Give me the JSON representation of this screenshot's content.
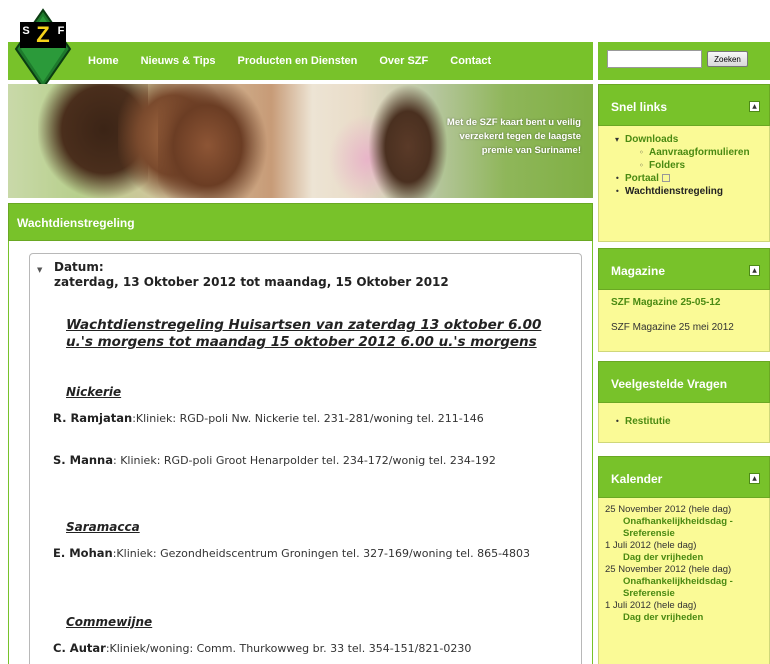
{
  "logo": {
    "letters": "SZF",
    "accent": "#78c22a"
  },
  "nav": {
    "items": [
      "Home",
      "Nieuws & Tips",
      "Producten en Diensten",
      "Over SZF",
      "Contact"
    ]
  },
  "search": {
    "value": "",
    "button_label": "Zoeken"
  },
  "banner": {
    "text": "Met de SZF kaart bent u veilig verzekerd tegen de laagste premie van Suriname!"
  },
  "main": {
    "header": "Wachtdienstregeling",
    "datum_label": "Datum:",
    "datum_value": "zaterdag, 13 Oktober 2012 tot maandag, 15 Oktober 2012",
    "title": "Wachtdienstregeling Huisartsen van zaterdag 13 oktober  6.00 u.'s morgens tot maandag 15 oktober 2012 6.00 u.'s morgens",
    "districts": [
      {
        "name": "Nickerie",
        "entries": [
          {
            "name": "R. Ramjatan",
            "detail": ":Kliniek:  RGD-poli Nw. Nickerie tel.  231-281/woning tel.  211-146"
          },
          {
            "name": "S. Manna",
            "detail": ": Kliniek: RGD-poli Groot Henarpolder tel. 234-172/wonig tel. 234-192"
          }
        ]
      },
      {
        "name": "Saramacca",
        "entries": [
          {
            "name": "E. Mohan",
            "detail": ":Kliniek:   Gezondheidscentrum Groningen tel.   327-169/woning tel.  865-4803"
          }
        ]
      },
      {
        "name": "Commewijne",
        "entries": [
          {
            "name": "C. Autar",
            "detail": ":Kliniek/woning:  Comm. Thurkowweg br. 33 tel.  354-151/821-0230"
          }
        ]
      }
    ]
  },
  "sidebar": {
    "quicklinks": {
      "title": "Snel links",
      "items": [
        {
          "label": "Downloads",
          "level": 1,
          "bullet": "▾"
        },
        {
          "label": "Aanvraagformulieren",
          "level": 2,
          "bullet": "◦"
        },
        {
          "label": "Folders",
          "level": 2,
          "bullet": "◦"
        },
        {
          "label": "Portaal",
          "level": 1,
          "bullet": "•",
          "external": true
        },
        {
          "label": "Wachtdienstregeling",
          "level": 1,
          "bullet": "•",
          "active": true
        }
      ]
    },
    "magazine": {
      "title": "Magazine",
      "link": "SZF Magazine 25-05-12",
      "text": "SZF Magazine 25 mei 2012"
    },
    "faq": {
      "title": "Veelgestelde Vragen",
      "items": [
        "Restitutie"
      ]
    },
    "kalender": {
      "title": "Kalender",
      "events": [
        {
          "date": "25 November 2012 (hele dag)",
          "title": "Onafhankelijkheidsdag - Sreferensie"
        },
        {
          "date": "1 Juli 2012 (hele dag)",
          "title": "Dag der vrijheden"
        },
        {
          "date": "25 November 2012 (hele dag)",
          "title": "Onafhankelijkheidsdag - Sreferensie"
        },
        {
          "date": "1 Juli 2012 (hele dag)",
          "title": "Dag der vrijheden"
        }
      ]
    }
  }
}
